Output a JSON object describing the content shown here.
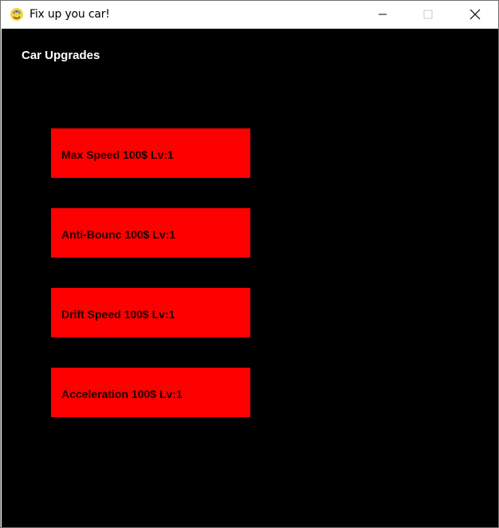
{
  "window": {
    "title": "Fix up you car!",
    "icon": "python-snake-icon"
  },
  "screen": {
    "title": "Car Upgrades",
    "background": "#000000"
  },
  "upgrades": [
    {
      "label": "Max Speed 100$ Lv:1"
    },
    {
      "label": "Anti-Bounc 100$ Lv:1"
    },
    {
      "label": "Drift Speed 100$ Lv:1"
    },
    {
      "label": "Acceleration 100$ Lv:1"
    }
  ],
  "colors": {
    "button": "#ff0000",
    "button_text": "#1a0000",
    "title_text": "#ffffff"
  }
}
